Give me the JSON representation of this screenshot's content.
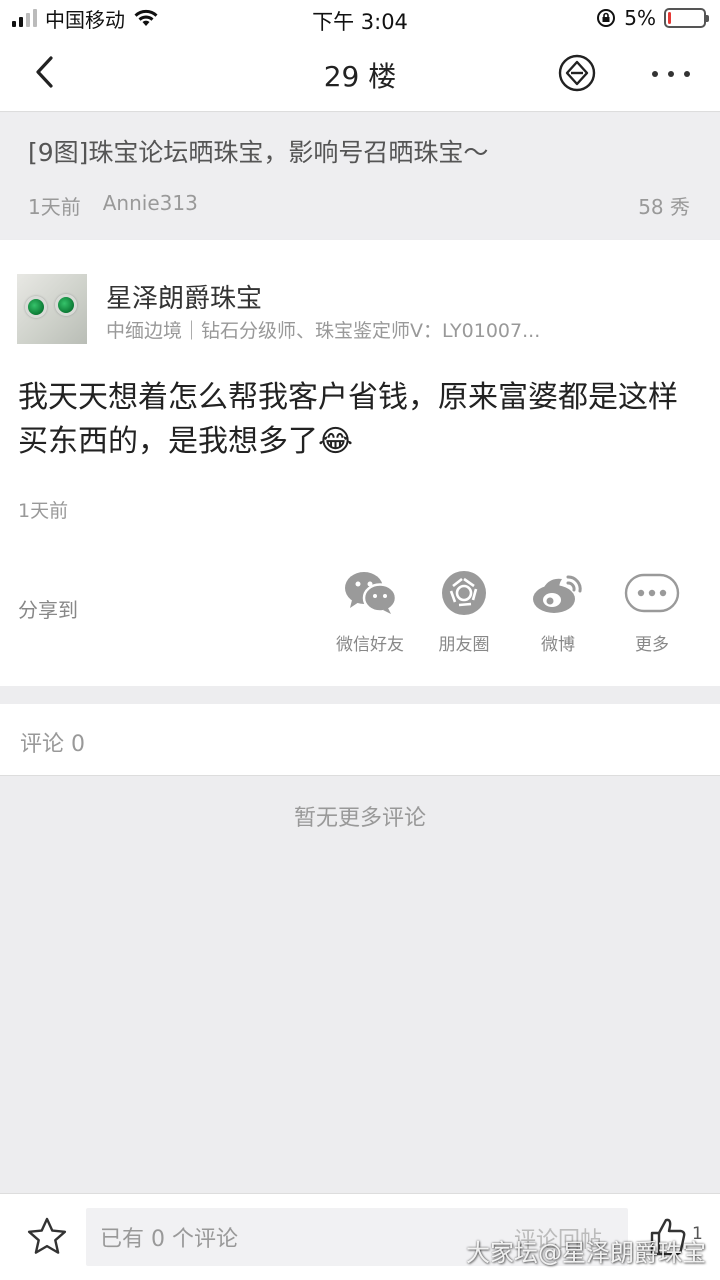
{
  "status_bar": {
    "carrier": "中国移动",
    "time": "下午 3:04",
    "battery": "5%",
    "battery_level": 0.05
  },
  "nav": {
    "title": "29 楼",
    "back_icon": "chevron-left-icon",
    "diamond_icon": "diamond-badge-icon",
    "more_icon": "more-dots-icon"
  },
  "thread": {
    "title": "[9图]珠宝论坛晒珠宝，影响号召晒珠宝～",
    "time": "1天前",
    "author": "Annie313",
    "views": "58 秀"
  },
  "post": {
    "author_name": "星泽朗爵珠宝",
    "author_desc": "中缅边境｜钻石分级师、珠宝鉴定师V：LY01007...",
    "content": "我天天想着怎么帮我客户省钱，原来富婆都是这样买东西的，是我想多了😂",
    "time": "1天前"
  },
  "share": {
    "label": "分享到",
    "items": [
      {
        "label": "微信好友",
        "icon": "wechat-icon"
      },
      {
        "label": "朋友圈",
        "icon": "moments-icon"
      },
      {
        "label": "微博",
        "icon": "weibo-icon"
      },
      {
        "label": "更多",
        "icon": "more-icon"
      }
    ]
  },
  "comments": {
    "header": "评论 0",
    "empty_text": "暂无更多评论"
  },
  "bottom_bar": {
    "input_placeholder": "已有 0 个评论",
    "send_label": "评论回帖",
    "like_count": "1"
  },
  "watermark": "大家坛@星泽朗爵珠宝",
  "colors": {
    "background": "#ededef",
    "battery_low": "#e53935"
  }
}
